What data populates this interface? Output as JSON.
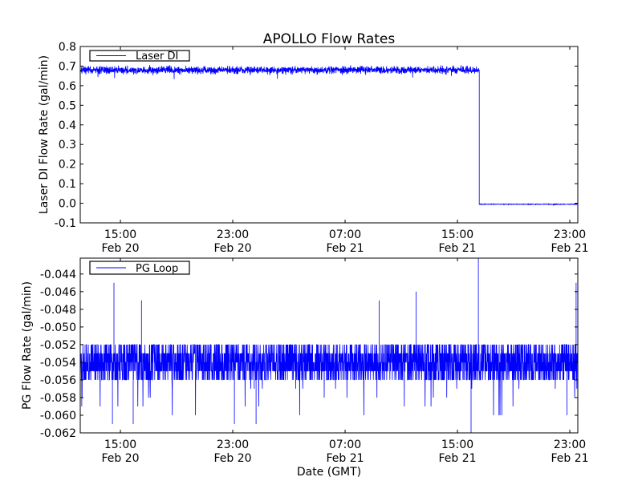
{
  "chart_data": [
    {
      "type": "line",
      "title": "APOLLO Flow Rates",
      "xlabel": "",
      "ylabel": "Laser DI Flow Rate (gal/min)",
      "x_units": "hours since Feb 20 00:00 GMT",
      "xlim": [
        12.14,
        47.57
      ],
      "ylim": [
        -0.1,
        0.8
      ],
      "yticks": [
        -0.1,
        0.0,
        0.1,
        0.2,
        0.3,
        0.4,
        0.5,
        0.6,
        0.7,
        0.8
      ],
      "ytick_labels": [
        "-0.1",
        "0.0",
        "0.1",
        "0.2",
        "0.3",
        "0.4",
        "0.5",
        "0.6",
        "0.7",
        "0.8"
      ],
      "xticks": [
        15,
        23,
        31,
        39,
        47
      ],
      "xtick_labels": [
        [
          "15:00",
          "Feb 20"
        ],
        [
          "23:00",
          "Feb 20"
        ],
        [
          "07:00",
          "Feb 21"
        ],
        [
          "15:00",
          "Feb 21"
        ],
        [
          "23:00",
          "Feb 21"
        ]
      ],
      "legend": {
        "label": "Laser DI",
        "placement": "top-left"
      },
      "color": "#0000ff",
      "grid": false,
      "series": [
        {
          "name": "Laser DI",
          "segments": [
            {
              "x_start": 12.14,
              "x_end": 40.55,
              "mean": 0.68,
              "noise": 0.012
            },
            {
              "x_start": 40.55,
              "x_end": 47.57,
              "mean": -0.005,
              "noise": 0.001
            }
          ]
        }
      ]
    },
    {
      "type": "line",
      "title": "",
      "xlabel": "Date (GMT)",
      "ylabel": "PG Flow Rate (gal/min)",
      "x_units": "hours since Feb 20 00:00 GMT",
      "xlim": [
        12.14,
        47.57
      ],
      "ylim": [
        -0.062,
        -0.0422
      ],
      "yticks": [
        -0.062,
        -0.06,
        -0.058,
        -0.056,
        -0.054,
        -0.052,
        -0.05,
        -0.048,
        -0.046,
        -0.044
      ],
      "ytick_labels": [
        "-0.062",
        "-0.060",
        "-0.058",
        "-0.056",
        "-0.054",
        "-0.052",
        "-0.050",
        "-0.048",
        "-0.046",
        "-0.044"
      ],
      "xticks": [
        15,
        23,
        31,
        39,
        47
      ],
      "xtick_labels": [
        [
          "15:00",
          "Feb 20"
        ],
        [
          "23:00",
          "Feb 20"
        ],
        [
          "07:00",
          "Feb 21"
        ],
        [
          "15:00",
          "Feb 21"
        ],
        [
          "23:00",
          "Feb 21"
        ]
      ],
      "legend": {
        "label": "PG Loop",
        "placement": "top-left"
      },
      "color": "#0000ff",
      "grid": false,
      "series": [
        {
          "name": "PG Loop",
          "band": [
            -0.056,
            -0.052
          ],
          "mean": -0.054,
          "quantum": 0.001,
          "spikes": [
            [
              14.54,
              -0.045
            ],
            [
              36.06,
              -0.046
            ],
            [
              33.43,
              -0.047
            ],
            [
              40.49,
              -0.042
            ],
            [
              47.45,
              -0.045
            ],
            [
              39.97,
              -0.062
            ],
            [
              23.12,
              -0.061
            ],
            [
              15.91,
              -0.061
            ],
            [
              14.43,
              -0.061
            ],
            [
              24.66,
              -0.061
            ],
            [
              46.8,
              -0.06
            ],
            [
              16.5,
              -0.047
            ]
          ]
        }
      ]
    }
  ]
}
